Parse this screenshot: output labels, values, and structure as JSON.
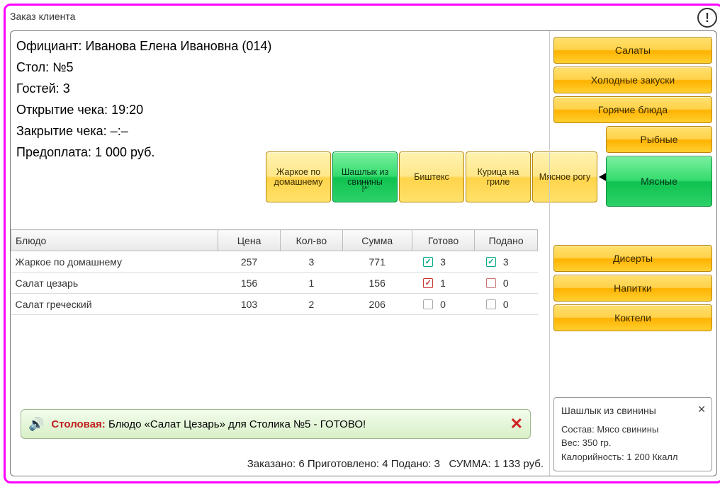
{
  "title": "Заказ клиента",
  "info": {
    "waiter_label": "Официант:",
    "waiter_value": "Иванова Елена Ивановна (014)",
    "table_label": "Стол:",
    "table_value": "№5",
    "guests_label": "Гостей:",
    "guests_value": "3",
    "open_label": "Открытие чека:",
    "open_value": "19:20",
    "close_label": "Закрытие чека:",
    "close_value": "–:–",
    "prepay_label": "Предоплата:",
    "prepay_value": "1 000 руб."
  },
  "dish_buttons": [
    "Жаркое по домашнему",
    "Шашлык из свинины",
    "Биштекс",
    "Курица на гриле",
    "Мясное рогу"
  ],
  "categories": {
    "salads": "Салаты",
    "cold": "Холодные закуски",
    "hot": "Горячие блюда",
    "fish": "Рыбные",
    "meat": "Мясные",
    "deserts": "Дисерты",
    "drinks": "Напитки",
    "cocktails": "Коктели"
  },
  "table": {
    "headers": {
      "dish": "Блюдо",
      "price": "Цена",
      "qty": "Кол-во",
      "sum": "Сумма",
      "ready": "Готово",
      "served": "Подано"
    },
    "rows": [
      {
        "name": "Жаркое по домашнему",
        "price": "257",
        "qty": "3",
        "sum": "771",
        "ready": "3",
        "ready_state": "green",
        "served": "3",
        "served_state": "green"
      },
      {
        "name": "Салат цезарь",
        "price": "156",
        "qty": "1",
        "sum": "156",
        "ready": "1",
        "ready_state": "red-check",
        "served": "0",
        "served_state": "empty-red"
      },
      {
        "name": "Салат греческий",
        "price": "103",
        "qty": "2",
        "sum": "206",
        "ready": "0",
        "ready_state": "empty",
        "served": "0",
        "served_state": "empty"
      }
    ]
  },
  "notification": {
    "prefix": "Столовая:",
    "rest": " Блюдо «Салат Цезарь» для Столика №5 - ГОТОВО!"
  },
  "totals": {
    "ordered_label": "Заказано:",
    "ordered": "6",
    "prepared_label": "Приготовлено:",
    "prepared": "4",
    "served_label": "Подано:",
    "served": "3",
    "sum_label": "СУММА:",
    "sum": "1 133 руб."
  },
  "card": {
    "title": "Шашлык из свинины",
    "line1_label": "Состав:",
    "line1_value": "Мясо свинины",
    "line2_label": "Вес:",
    "line2_value": "350 гр.",
    "line3_label": "Калорийность:",
    "line3_value": "1 200 Ккалл"
  }
}
